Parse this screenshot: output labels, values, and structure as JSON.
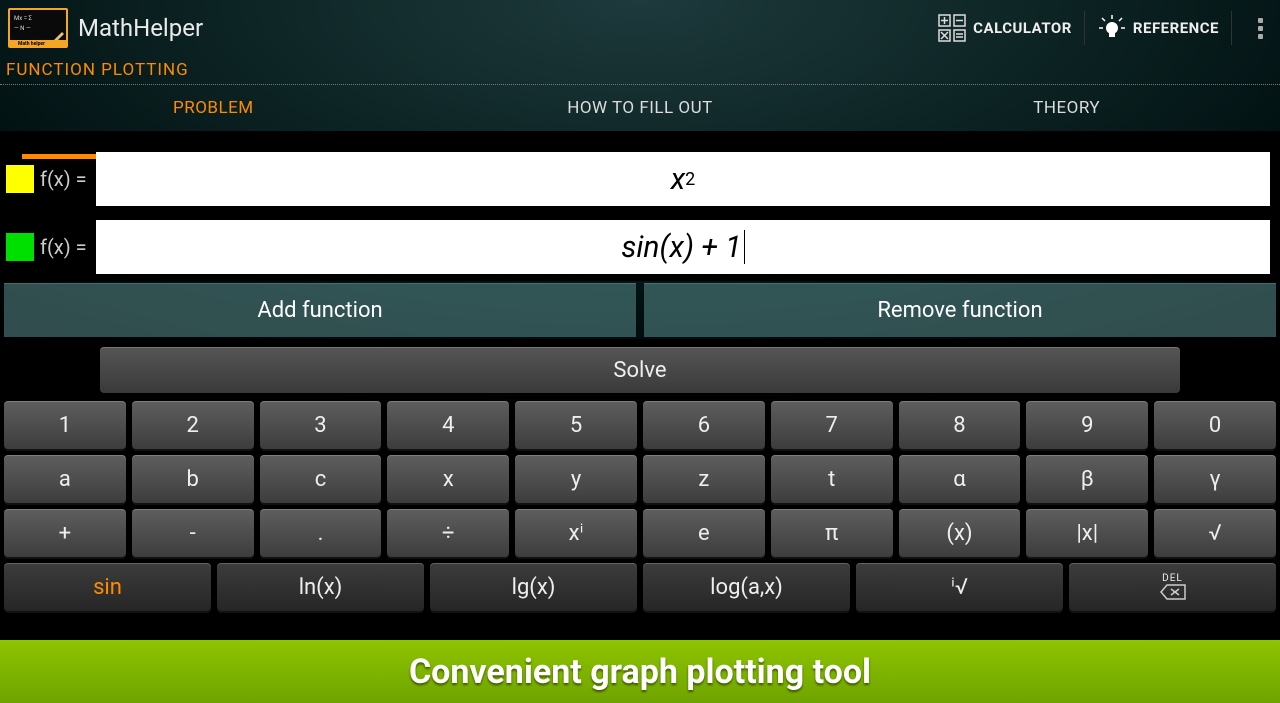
{
  "header": {
    "app_title": "MathHelper",
    "calculator_label": "CALCULATOR",
    "reference_label": "REFERENCE"
  },
  "section_title": "FUNCTION PLOTTING",
  "tabs": {
    "problem": "PROBLEM",
    "howto": "HOW TO FILL OUT",
    "theory": "THEORY"
  },
  "functions": {
    "f1": {
      "label": "f(x) =",
      "value_base": "x",
      "value_exp": "2",
      "color": "#ffff00"
    },
    "f2": {
      "label": "f(x) =",
      "value": "sin(x) + 1",
      "color": "#00e000"
    }
  },
  "actions": {
    "add": "Add function",
    "remove": "Remove function",
    "solve": "Solve"
  },
  "keypad": {
    "row1": [
      "1",
      "2",
      "3",
      "4",
      "5",
      "6",
      "7",
      "8",
      "9",
      "0"
    ],
    "row2": [
      "a",
      "b",
      "c",
      "x",
      "y",
      "z",
      "t",
      "α",
      "β",
      "γ"
    ],
    "row3": [
      "+",
      "-",
      ".",
      "÷",
      "xⁱ",
      "e",
      "π",
      "(x)",
      "|x|",
      "√"
    ],
    "row4": [
      "sin",
      "ln(x)",
      "lg(x)",
      "log(a,x)",
      "ⁱ√",
      "DEL"
    ]
  },
  "banner": "Convenient graph plotting tool"
}
